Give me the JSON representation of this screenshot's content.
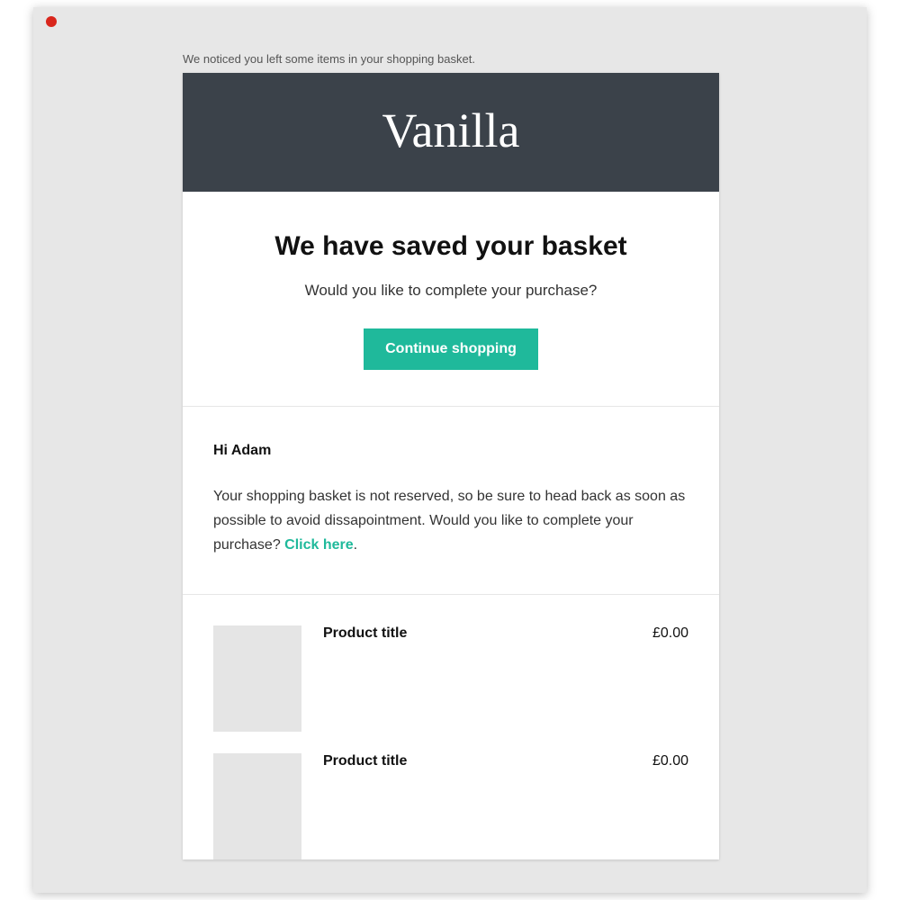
{
  "preheader": "We noticed you left some items in your shopping basket.",
  "brand": "Vanilla",
  "hero": {
    "title": "We have saved your basket",
    "subtitle": "Would you like to complete your purchase?",
    "cta": "Continue shopping"
  },
  "message": {
    "greeting": "Hi Adam",
    "body_before": "Your shopping basket is not reserved, so be sure to head back as soon as possible to avoid dissapointment. Would you like to complete your purchase? ",
    "link_text": "Click here",
    "body_after": "."
  },
  "products": [
    {
      "title": "Product title",
      "price": "£0.00"
    },
    {
      "title": "Product title",
      "price": "£0.00"
    }
  ],
  "colors": {
    "header_bg": "#3b424a",
    "accent": "#1fb99b",
    "window_bg": "#e7e7e7"
  }
}
